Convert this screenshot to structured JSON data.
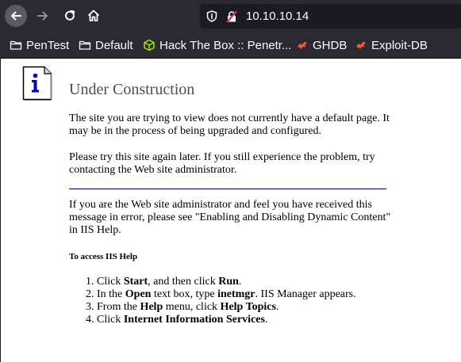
{
  "browser": {
    "url": "10.10.10.14",
    "bookmarks": [
      {
        "label": "PenTest",
        "icon": "folder-icon"
      },
      {
        "label": "Default",
        "icon": "folder-icon"
      },
      {
        "label": "Hack The Box :: Penetr...",
        "icon": "htb-cube-icon"
      },
      {
        "label": "GHDB",
        "icon": "exploit-db-icon"
      },
      {
        "label": "Exploit-DB",
        "icon": "exploit-db-icon"
      }
    ]
  },
  "page": {
    "title": "Under Construction",
    "paragraph1": "The site you are trying to view does not currently have a default page. It may be in the process of being upgraded and configured.",
    "paragraph2": "Please try this site again later. If you still experience the problem, try contacting the Web site administrator.",
    "paragraph3": "If you are the Web site administrator and feel you have received this message in error, please see \"Enabling and Disabling Dynamic Content\" in IIS Help.",
    "help_heading": "To access IIS Help",
    "steps": [
      {
        "n": "1.",
        "parts": [
          "Click ",
          "Start",
          ", and then click ",
          "Run",
          "."
        ]
      },
      {
        "n": "2.",
        "parts": [
          "In the ",
          "Open",
          " text box, type ",
          "inetmgr",
          ". IIS Manager appears."
        ]
      },
      {
        "n": "3.",
        "parts": [
          "From the ",
          "Help",
          " menu, click ",
          "Help Topics",
          "."
        ]
      },
      {
        "n": "4.",
        "parts": [
          "Click ",
          "Internet Information Services",
          "."
        ]
      }
    ]
  },
  "colors": {
    "chrome_bg": "#2b2a33",
    "urlbar_bg": "#1c1b22",
    "title_gray": "#4e4e4e",
    "divider_navy": "#000080",
    "info_icon_blue": "#0000cc"
  }
}
